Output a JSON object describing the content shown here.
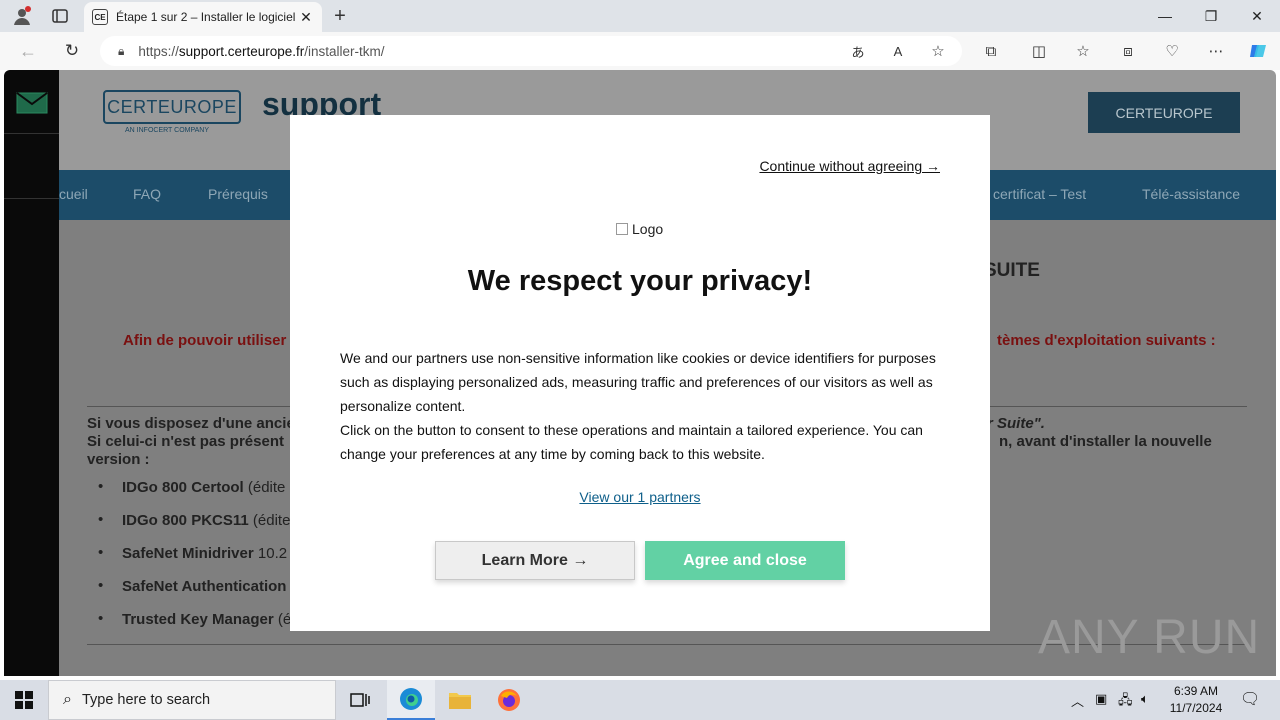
{
  "browser": {
    "tab_title": "Étape 1 sur 2 – Installer le logiciel",
    "tab_favicon": "CE",
    "url_prefix": "https://",
    "url_domain": "support.certeurope.fr",
    "url_path": "/installer-tkm/"
  },
  "site": {
    "logo_text": "CERTEUROPE",
    "logo_sub": "AN INFOCERT COMPANY",
    "support_word": "support",
    "header_button": "CERTEUROPE",
    "nav": {
      "accueil": "cueil",
      "faq": "FAQ",
      "prerequis": "Prérequis",
      "certificat_test": "certificat – Test",
      "teleassistance": "Télé-assistance"
    },
    "page_title_fragment": "SUITE",
    "red_left": "Afin de pouvoir utiliser",
    "red_right": "tèmes d'exploitation suivants :",
    "para1_left": "Si vous disposez d'une ancie",
    "para1_right": "r Suite\".",
    "para2_left": "Si celui-ci n'est pas présent",
    "para2_right": "n, avant d'installer la nouvelle",
    "para3": "version :",
    "bullets": [
      {
        "bold": "IDGo 800 Certool",
        "rest": " (édite"
      },
      {
        "bold": "IDGo 800 PKCS11",
        "rest": " (édite"
      },
      {
        "bold": "SafeNet Minidriver",
        "rest": " 10.2"
      },
      {
        "bold": "SafeNet Authentication",
        "rest": ""
      },
      {
        "bold": "Trusted Key Manager",
        "rest": " (é"
      }
    ]
  },
  "modal": {
    "continue_link": "Continue without agreeing →",
    "logo_alt": "Logo",
    "title": "We respect your privacy!",
    "text_line1": "We and our partners use non-sensitive information like cookies or device identifiers for purposes such as displaying personalized ads, measuring traffic and preferences of our visitors as well as personalize content.",
    "text_line2": "Click on the button to consent to these operations and maintain a tailored experience. You can change your preferences at any time by coming back to this website.",
    "partners_link": "View our 1 partners",
    "learn_more": "Learn More →",
    "agree": "Agree and close"
  },
  "watermark": "ANY RUN",
  "taskbar": {
    "search_placeholder": "Type here to search",
    "time": "6:39 AM",
    "date": "11/7/2024"
  },
  "colors": {
    "agree_button": "#62d1a4",
    "nav_bar": "#1c4c69",
    "link": "#0e5f8a"
  }
}
